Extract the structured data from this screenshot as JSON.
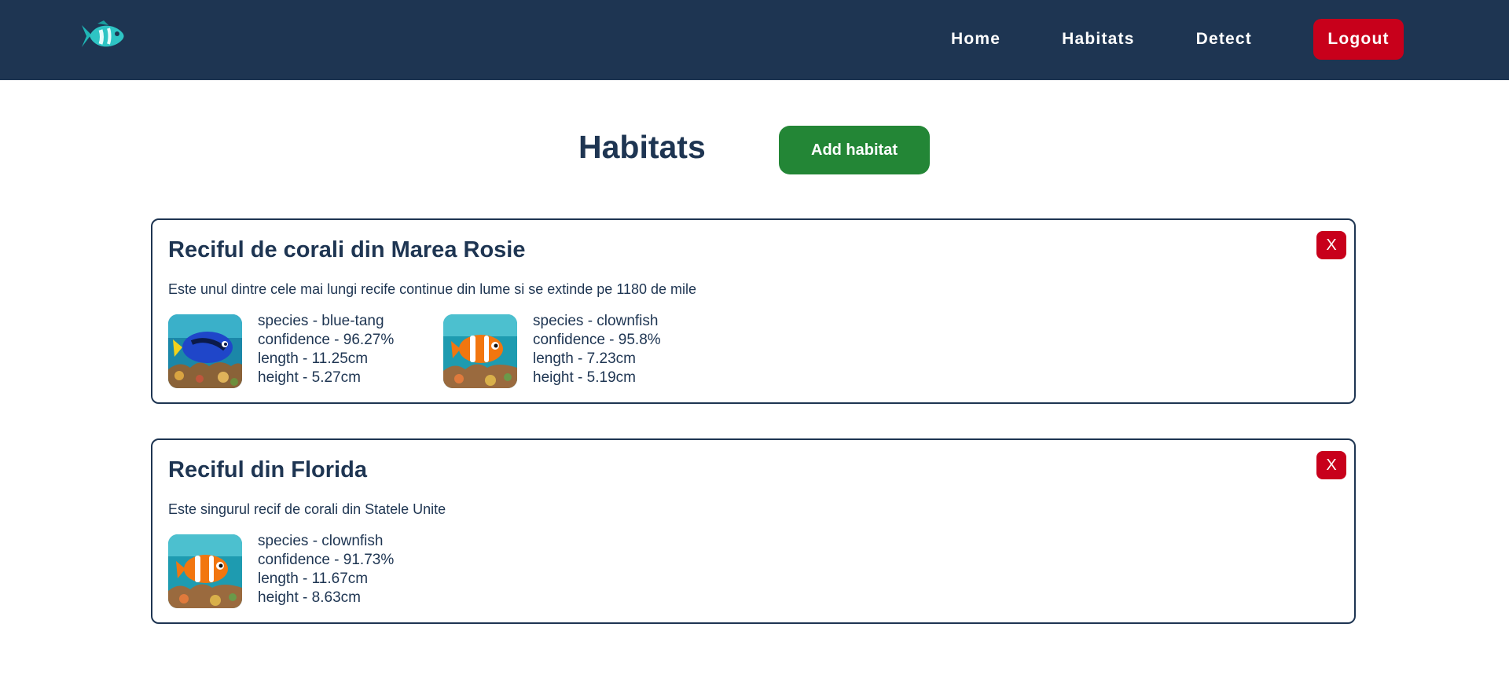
{
  "nav": {
    "logo_icon": "fish-logo-icon",
    "links": [
      {
        "label": "Home"
      },
      {
        "label": "Habitats"
      },
      {
        "label": "Detect"
      }
    ],
    "logout_label": "Logout"
  },
  "page": {
    "title": "Habitats",
    "add_button_label": "Add habitat"
  },
  "habitats": [
    {
      "name": "Reciful de corali din Marea Rosie",
      "description": "Este unul dintre cele mai lungi recife continue din lume si se extinde pe 1180 de mile",
      "delete_label": "X",
      "fish": [
        {
          "image": "blue-tang-image",
          "species": "species - blue-tang",
          "confidence": "confidence - 96.27%",
          "length": "length - 11.25cm",
          "height": "height - 5.27cm"
        },
        {
          "image": "clownfish-image",
          "species": "species - clownfish",
          "confidence": "confidence - 95.8%",
          "length": "length - 7.23cm",
          "height": "height - 5.19cm"
        }
      ]
    },
    {
      "name": "Reciful din Florida",
      "description": "Este singurul recif de corali din Statele Unite",
      "delete_label": "X",
      "fish": [
        {
          "image": "clownfish-image",
          "species": "species - clownfish",
          "confidence": "confidence - 91.73%",
          "length": "length - 11.67cm",
          "height": "height - 8.63cm"
        }
      ]
    }
  ],
  "colors": {
    "navy": "#1e3552",
    "danger": "#c8001b",
    "success": "#238636",
    "logo_teal": "#1fb5b5"
  }
}
